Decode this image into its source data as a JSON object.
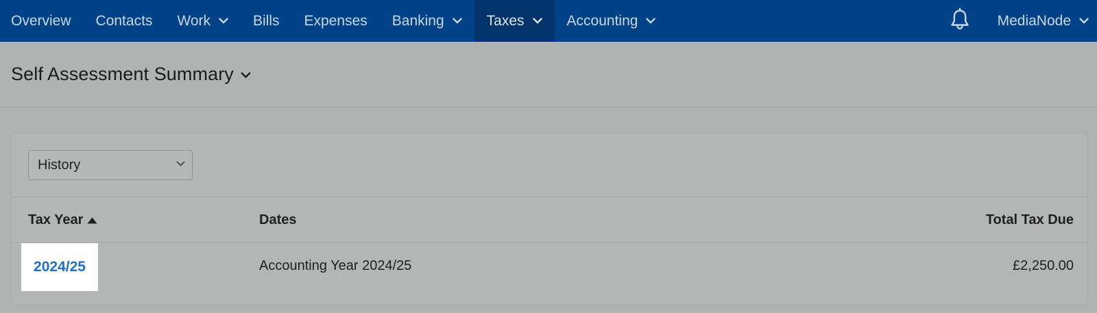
{
  "nav": {
    "items": [
      {
        "label": "Overview",
        "dropdown": false,
        "active": false
      },
      {
        "label": "Contacts",
        "dropdown": false,
        "active": false
      },
      {
        "label": "Work",
        "dropdown": true,
        "active": false
      },
      {
        "label": "Bills",
        "dropdown": false,
        "active": false
      },
      {
        "label": "Expenses",
        "dropdown": false,
        "active": false
      },
      {
        "label": "Banking",
        "dropdown": true,
        "active": false
      },
      {
        "label": "Taxes",
        "dropdown": true,
        "active": true
      },
      {
        "label": "Accounting",
        "dropdown": true,
        "active": true
      }
    ],
    "account_label": "MediaNode",
    "colors": {
      "bar": "#004287",
      "active": "#03336b",
      "text": "#c9d8ea"
    }
  },
  "page": {
    "title": "Self Assessment Summary"
  },
  "filter": {
    "selected": "History"
  },
  "table": {
    "columns": {
      "tax_year": "Tax Year",
      "dates": "Dates",
      "total": "Total Tax Due"
    },
    "sort": "ascending",
    "rows": [
      {
        "tax_year": "2024/25",
        "dates": "Accounting Year 2024/25",
        "total": "£2,250.00"
      }
    ]
  },
  "colors": {
    "link": "#1d6fc9",
    "highlight": "#ffffff"
  }
}
